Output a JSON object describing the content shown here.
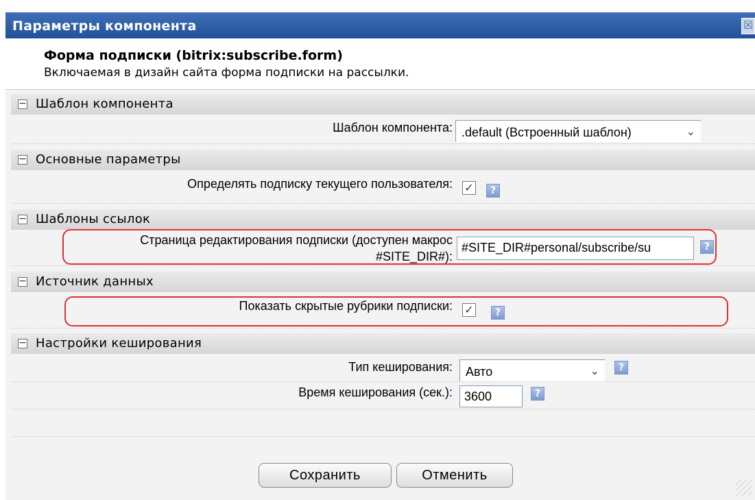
{
  "dialog": {
    "title": "Параметры компонента",
    "close_glyph": "☒"
  },
  "header": {
    "component_title": "Форма подписки (bitrix:subscribe.form)",
    "component_desc": "Включаемая в дизайн сайта форма подписки на рассылки."
  },
  "sections": [
    {
      "label": "Шаблон компонента",
      "toggle": "−",
      "fields": [
        {
          "label": "Шаблон компонента:",
          "type": "select",
          "value": ".default (Встроенный шаблон)"
        }
      ]
    },
    {
      "label": "Основные параметры",
      "toggle": "−",
      "fields": [
        {
          "label": "Определять подписку текущего пользователя:",
          "type": "checkbox",
          "checked": true
        }
      ]
    },
    {
      "label": "Шаблоны ссылок",
      "toggle": "−",
      "fields": [
        {
          "label_line1": "Страница редактирования подписки (доступен макрос",
          "label_line2": "#SITE_DIR#):",
          "type": "text",
          "value": "#SITE_DIR#personal/subscribe/su"
        }
      ]
    },
    {
      "label": "Источник данных",
      "toggle": "−",
      "fields": [
        {
          "label": "Показать скрытые рубрики подписки:",
          "type": "checkbox",
          "checked": true
        }
      ]
    },
    {
      "label": "Настройки кеширования",
      "toggle": "−",
      "fields": [
        {
          "label": "Тип кеширования:",
          "type": "select",
          "value": "Авто"
        },
        {
          "label": "Время кеширования (сек.):",
          "type": "text",
          "value": "3600"
        }
      ]
    }
  ],
  "icons": {
    "check": "✓",
    "help": "?",
    "chevron": "⌄"
  },
  "buttons": {
    "save": "Сохранить",
    "cancel": "Отменить"
  },
  "colors": {
    "titlebar": "#2f5da8",
    "highlight": "#e03030"
  }
}
